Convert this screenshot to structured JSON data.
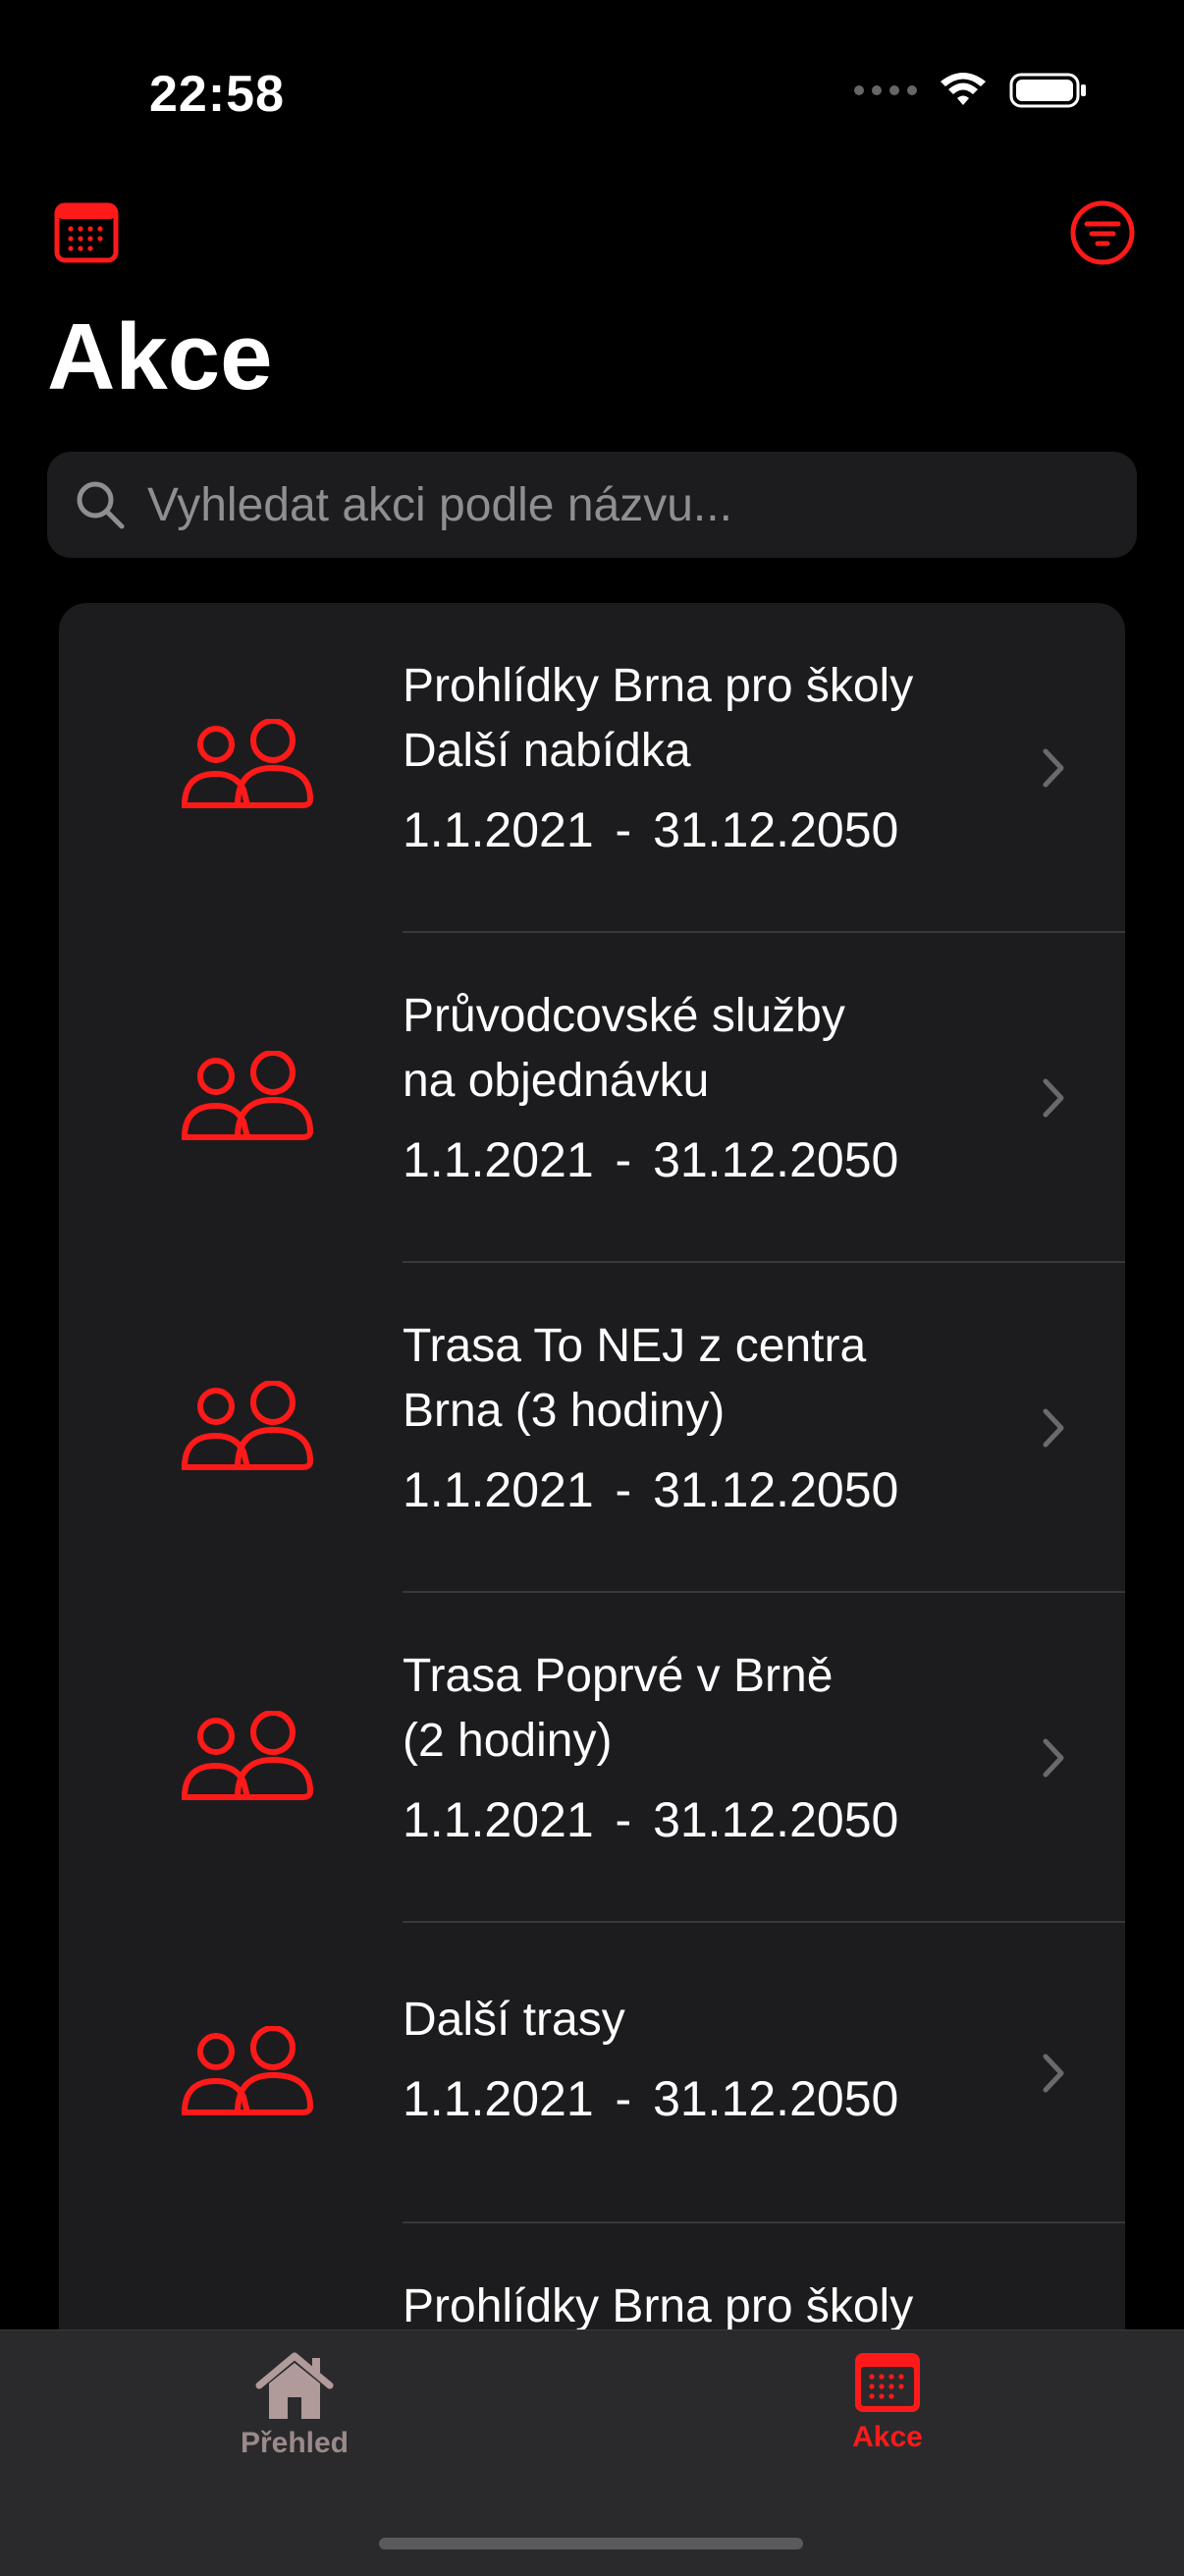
{
  "status_bar": {
    "time": "22:58"
  },
  "header": {
    "title": "Akce"
  },
  "search": {
    "placeholder": "Vyhledat akci podle názvu..."
  },
  "events": [
    {
      "title_line1": "Prohlídky Brna pro školy",
      "title_line2": "Další nabídka",
      "dates": "1.1.2021 - 31.12.2050"
    },
    {
      "title_line1": "Průvodcovské služby",
      "title_line2": "na objednávku",
      "dates": "1.1.2021 - 31.12.2050"
    },
    {
      "title_line1": "Trasa To NEJ z centra",
      "title_line2": "Brna (3 hodiny)",
      "dates": "1.1.2021 - 31.12.2050"
    },
    {
      "title_line1": "Trasa Poprvé v Brně",
      "title_line2": "(2 hodiny)",
      "dates": "1.1.2021 - 31.12.2050"
    },
    {
      "title_line1": "Další trasy",
      "title_line2": "",
      "dates": "1.1.2021 - 31.12.2050"
    },
    {
      "title_line1": "Prohlídky Brna pro školy",
      "title_line2": "",
      "dates": ""
    }
  ],
  "tab_bar": {
    "home_label": "Přehled",
    "akce_label": "Akce"
  },
  "colors": {
    "accent": "#ff1a1a",
    "background": "#000000",
    "card": "#1c1c1e"
  }
}
